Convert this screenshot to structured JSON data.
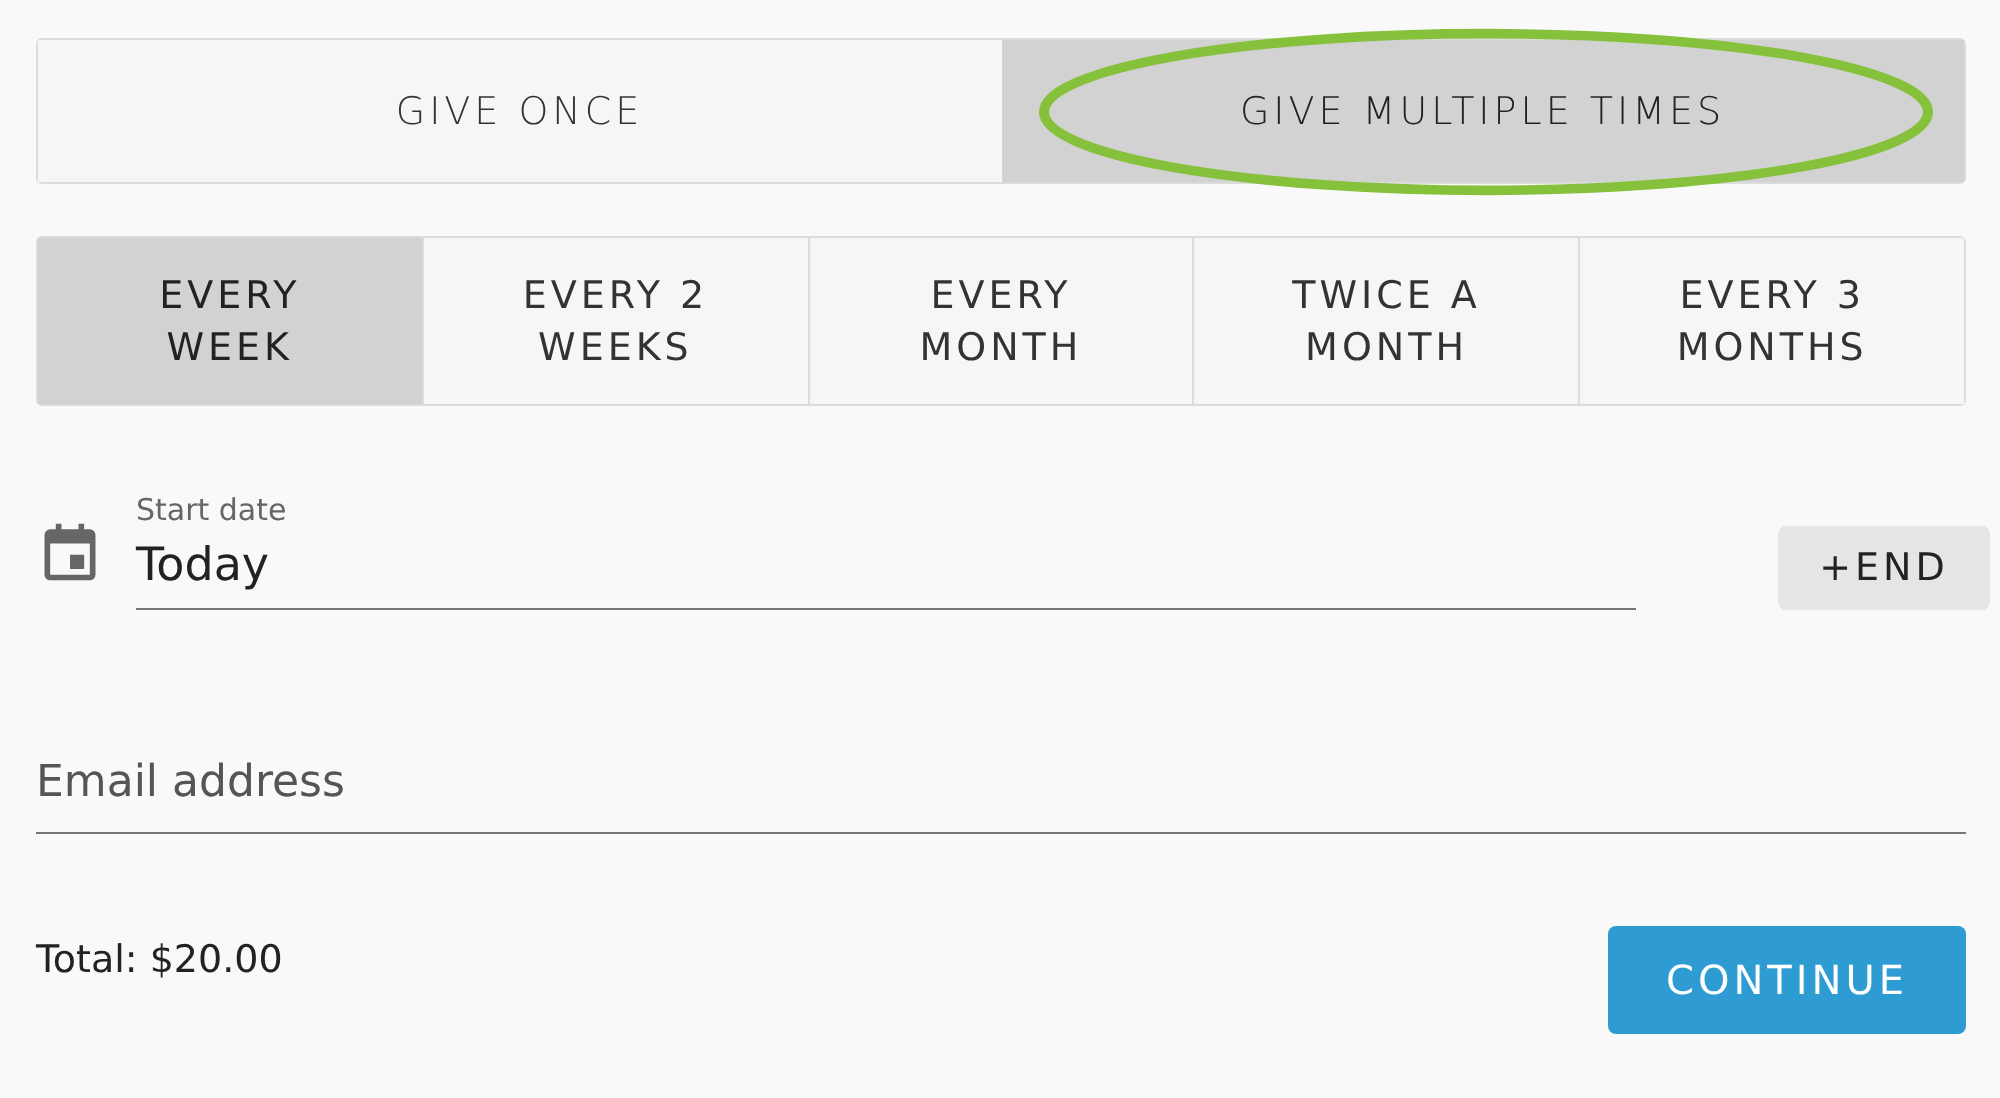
{
  "give_mode": [
    {
      "label": "GIVE ONCE",
      "selected": false,
      "highlighted": false
    },
    {
      "label": "GIVE MULTIPLE TIMES",
      "selected": true,
      "highlighted": true
    }
  ],
  "frequency": [
    {
      "label": "EVERY\nWEEK",
      "selected": true
    },
    {
      "label": "EVERY 2\nWEEKS",
      "selected": false
    },
    {
      "label": "EVERY\nMONTH",
      "selected": false
    },
    {
      "label": "TWICE A\nMONTH",
      "selected": false
    },
    {
      "label": "EVERY 3\nMONTHS",
      "selected": false
    }
  ],
  "start_date": {
    "label": "Start date",
    "value": "Today"
  },
  "end_button": "+END",
  "email": {
    "placeholder": "Email address"
  },
  "total": "Total: $20.00",
  "continue_button": "CONTINUE"
}
